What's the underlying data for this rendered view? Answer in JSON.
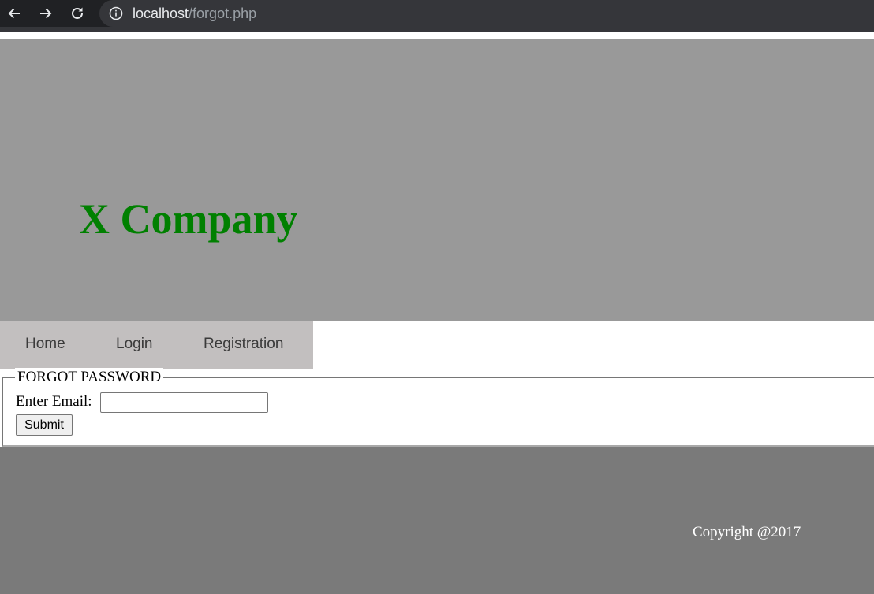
{
  "browser": {
    "url_host": "localhost",
    "url_path": "/forgot.php",
    "icons": [
      "back-arrow-icon",
      "forward-arrow-icon",
      "reload-icon",
      "info-icon"
    ]
  },
  "header": {
    "title": "X Company",
    "title_color": "#008000",
    "background": "#999999"
  },
  "nav": {
    "items": [
      {
        "label": "Home"
      },
      {
        "label": "Login"
      },
      {
        "label": "Registration"
      }
    ],
    "background": "#c2bfbf"
  },
  "form": {
    "legend": "FORGOT PASSWORD",
    "email_label": "Enter Email:",
    "email_value": "",
    "submit_label": "Submit"
  },
  "footer": {
    "copyright": "Copyright @2017",
    "background": "#7a7a7a"
  }
}
